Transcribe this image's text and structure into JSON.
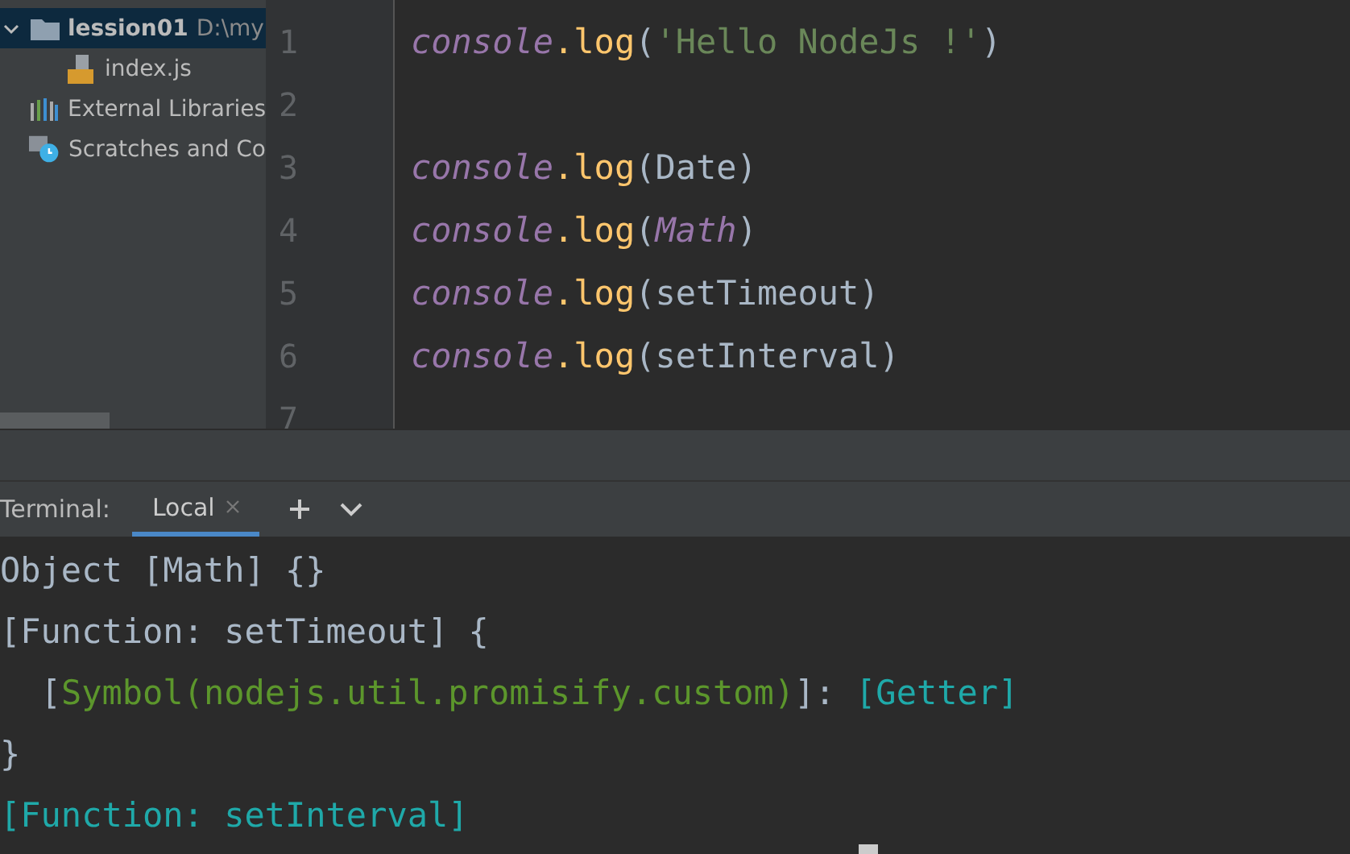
{
  "project_tree": [
    {
      "label": "lession01",
      "path": "D:\\my",
      "kind": "folder",
      "expanded": true,
      "selected": true,
      "children": [
        {
          "label": "index.js",
          "kind": "js",
          "selected": false
        }
      ]
    },
    {
      "label": "External Libraries",
      "kind": "libraries",
      "selected": false
    },
    {
      "label": "Scratches and Co",
      "kind": "scratches",
      "selected": false
    }
  ],
  "editor": {
    "lines": [
      {
        "number": "1",
        "tokens": [
          {
            "text": "console",
            "kind": "object"
          },
          {
            "text": ".log",
            "kind": "method"
          },
          {
            "text": "(",
            "kind": "plain"
          },
          {
            "text": "'Hello NodeJs !'",
            "kind": "string"
          },
          {
            "text": ")",
            "kind": "plain"
          }
        ]
      },
      {
        "number": "2"
      },
      {
        "number": "3",
        "tokens": [
          {
            "text": "console",
            "kind": "object"
          },
          {
            "text": ".log",
            "kind": "method"
          },
          {
            "text": "(Date)",
            "kind": "plain"
          }
        ]
      },
      {
        "number": "4",
        "tokens": [
          {
            "text": "console",
            "kind": "object"
          },
          {
            "text": ".log",
            "kind": "method"
          },
          {
            "text": "(",
            "kind": "plain"
          },
          {
            "text": "Math",
            "kind": "object"
          },
          {
            "text": ")",
            "kind": "plain"
          }
        ]
      },
      {
        "number": "5",
        "tokens": [
          {
            "text": "console",
            "kind": "object"
          },
          {
            "text": ".log",
            "kind": "method"
          },
          {
            "text": "(setTimeout)",
            "kind": "plain"
          }
        ]
      },
      {
        "number": "6",
        "tokens": [
          {
            "text": "console",
            "kind": "object"
          },
          {
            "text": ".log",
            "kind": "method"
          },
          {
            "text": "(setInterval)",
            "kind": "plain"
          }
        ]
      },
      {
        "number": "7"
      }
    ]
  },
  "terminal": {
    "label": "Terminal:",
    "tabs": [
      {
        "label": "Local",
        "selected": true,
        "closable": true
      }
    ],
    "lines": [
      [
        {
          "text": "Object [Math] {}",
          "kind": "plain"
        }
      ],
      [
        {
          "text": "[Function: setTimeout] {",
          "kind": "plain"
        }
      ],
      [
        {
          "text": "  [",
          "kind": "plain"
        },
        {
          "text": "Symbol(nodejs.util.promisify.custom)",
          "kind": "green"
        },
        {
          "text": "]: ",
          "kind": "plain"
        },
        {
          "text": "[Getter]",
          "kind": "cyan"
        }
      ],
      [
        {
          "text": "}",
          "kind": "plain"
        }
      ],
      [
        {
          "text": "[Function: setInterval]",
          "kind": "cyan"
        }
      ]
    ]
  }
}
